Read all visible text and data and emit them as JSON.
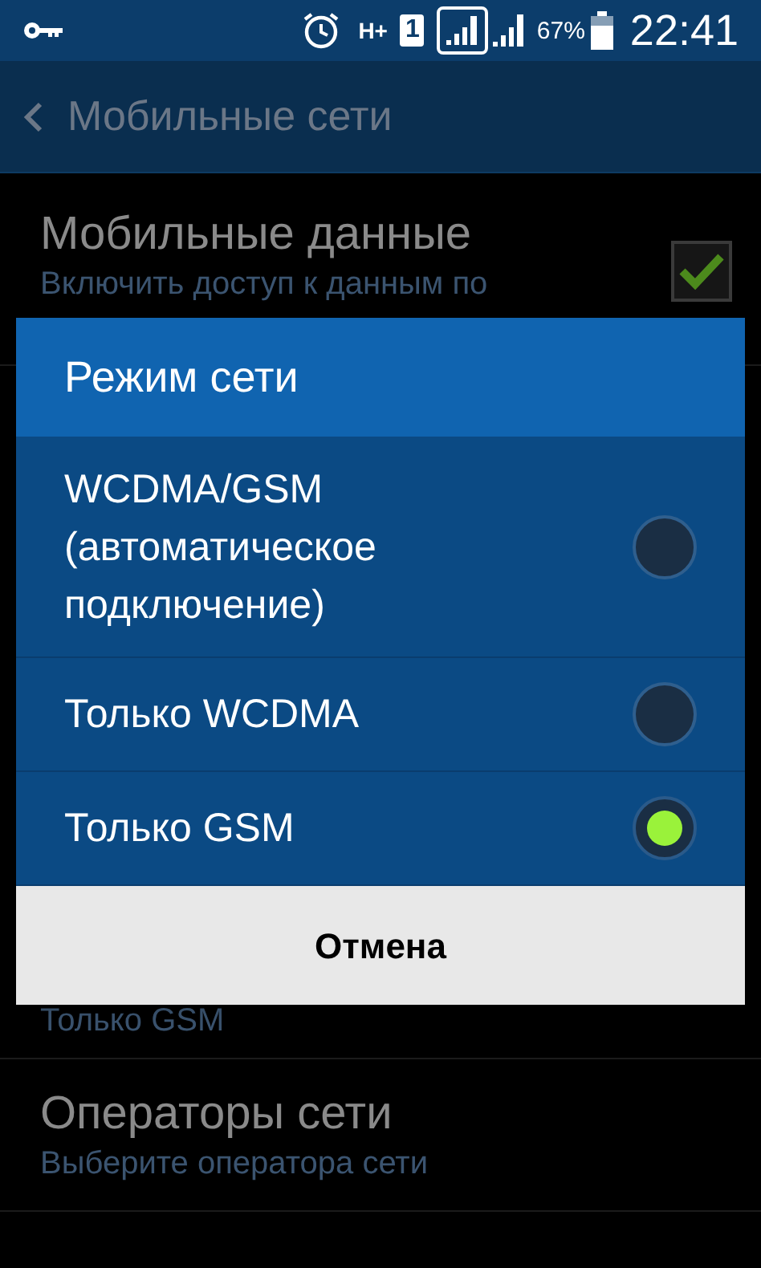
{
  "status_bar": {
    "network_type": "H+",
    "sim_slot": "1",
    "battery": "67%",
    "time": "22:41"
  },
  "action_bar": {
    "title": "Мобильные сети"
  },
  "settings": [
    {
      "kind": "checkbox",
      "title": "Мобильные данные",
      "summary": "Включить доступ к данным по",
      "checked": true
    },
    {
      "kind": "value",
      "summary": "Только GSM"
    },
    {
      "kind": "plain",
      "title": "Операторы сети",
      "summary": "Выберите оператора сети"
    }
  ],
  "dialog": {
    "title": "Режим сети",
    "options": [
      {
        "label": "WCDMA/GSM (автоматическое подключение)",
        "selected": false
      },
      {
        "label": "Только WCDMA",
        "selected": false
      },
      {
        "label": "Только GSM",
        "selected": true
      }
    ],
    "cancel": "Отмена"
  }
}
